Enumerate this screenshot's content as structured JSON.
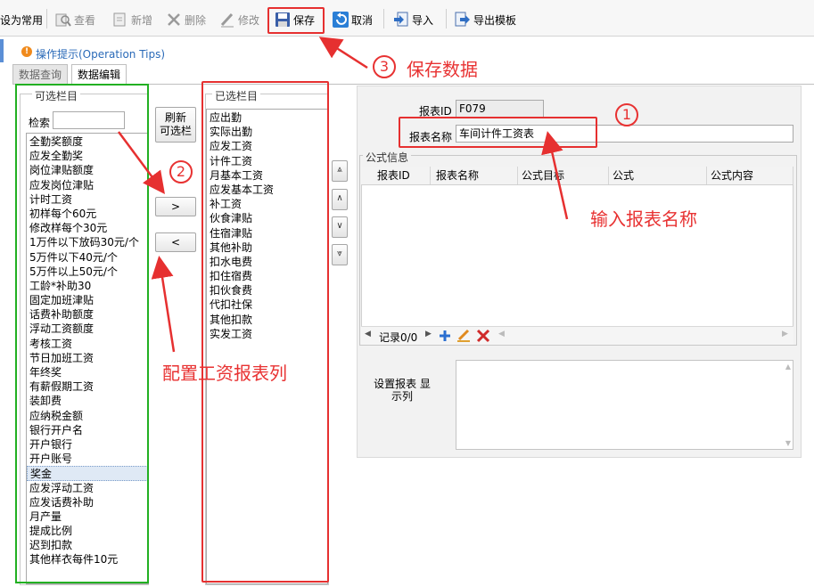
{
  "toolbar": {
    "set_common": "设为常用",
    "view": "查看",
    "add": "新增",
    "delete": "删除",
    "edit": "修改",
    "save": "保存",
    "cancel": "取消",
    "import": "导入",
    "export_template": "导出模板"
  },
  "tips": {
    "text": "操作提示(Operation Tips)"
  },
  "tabs": [
    {
      "label": "数据查询"
    },
    {
      "label": "数据编辑"
    }
  ],
  "available": {
    "legend": "可选栏目",
    "search_label": "检索",
    "search_value": "",
    "items": [
      "全勤奖额度",
      "应发全勤奖",
      "岗位津贴额度",
      "应发岗位津贴",
      "计时工资",
      "初样每个60元",
      "修改样每个30元",
      "1万件以下放码30元/个",
      "5万件以下40元/个",
      "5万件以上50元/个",
      "工龄*补助30",
      "固定加班津贴",
      "话费补助额度",
      "浮动工资额度",
      "考核工资",
      "节日加班工资",
      "年终奖",
      "有薪假期工资",
      "装卸费",
      "应纳税金额",
      "银行开户名",
      "开户银行",
      "开户账号",
      "奖金",
      "应发浮动工资",
      "应发话费补助",
      "月产量",
      "提成比例",
      "迟到扣款",
      "其他样衣每件10元"
    ],
    "selected_item": "奖金"
  },
  "middle": {
    "refresh_label": "刷新\n可选栏",
    "add_label": ">",
    "remove_label": "<"
  },
  "chosen": {
    "legend": "已选栏目",
    "items": [
      "应出勤",
      "实际出勤",
      "应发工资",
      "计件工资",
      "月基本工资",
      "应发基本工资",
      "补工资",
      "伙食津贴",
      "住宿津贴",
      "其他补助",
      "扣水电费",
      "扣住宿费",
      "扣伙食费",
      "代扣社保",
      "其他扣款",
      "实发工资"
    ]
  },
  "order_buttons": [
    "⩓",
    "∧",
    "∨",
    "⩔"
  ],
  "form": {
    "report_id_label": "报表ID",
    "report_id_value": "F079",
    "report_name_label": "报表名称",
    "report_name_value": "车间计件工资表",
    "formula_group": "公式信息",
    "columns": [
      "报表ID",
      "报表名称",
      "公式目标",
      "公式",
      "公式内容"
    ],
    "record_nav": "记录0/0",
    "display_label": "设置报表 显\n示列"
  },
  "annotations": {
    "step1_num": "1",
    "step1_text": "输入报表名称",
    "step2_num": "2",
    "step2_text": "配置工资报表列",
    "step3_num": "3",
    "step3_text": "保存数据"
  },
  "colors": {
    "annotation_red": "#e63030",
    "annotation_green": "#22b022",
    "tip_blue": "#2a6ab8"
  }
}
